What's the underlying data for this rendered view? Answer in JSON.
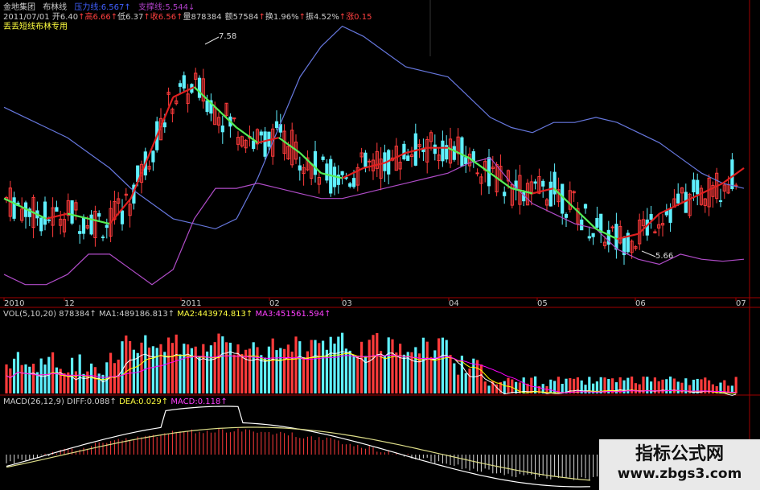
{
  "header": {
    "stock": "金地集团",
    "indicator": "布林线",
    "resist_label": "压力线:",
    "resist_value": "6.567",
    "support_label": "支撑线:",
    "support_value": "5.544",
    "line2": {
      "date": "2011/07/01",
      "open": "开6.40",
      "high": "高6.66",
      "low": "低6.37",
      "close": "收6.56",
      "volume": "量878384",
      "amount": "额57584",
      "turnover": "换1.96%",
      "amplitude": "振4.52%",
      "change": "涨0.15"
    },
    "subtitle": "丢丢短线布林专用"
  },
  "vol_header": {
    "label": "VOL(5,10,20)",
    "value": "878384",
    "ma1": "MA1:489186.813",
    "ma2": "MA2:443974.813",
    "ma3": "MA3:451561.594"
  },
  "macd_header": {
    "label": "MACD(26,12,9)",
    "diff": "DIFF:0.088",
    "dea": "DEA:0.029",
    "macd": "MACD:0.118"
  },
  "watermark": {
    "line1": "指标公式网",
    "line2": "www.zbgs3.com"
  },
  "colors": {
    "up": "#ff3b3b",
    "down": "#5ff0ff",
    "upper_band": "#6677dd",
    "lower_band": "#b04cc8",
    "mid_up": "#e02020",
    "mid_down": "#55ee55",
    "axis_red": "#a00000",
    "vol_ma1": "#ffffff",
    "vol_ma2": "#ffff00",
    "vol_ma3": "#ff00ff"
  },
  "chart_data": {
    "type": "candlestick",
    "x_ticks": [
      "2010",
      "12",
      "2011",
      "02",
      "03",
      "04",
      "05",
      "06",
      "07"
    ],
    "annotations": [
      {
        "text": "7.58",
        "kind": "high"
      },
      {
        "text": "5.66",
        "kind": "low"
      }
    ],
    "price_ylim": [
      5.2,
      7.9
    ],
    "upper_band": [
      7.0,
      6.9,
      6.8,
      6.7,
      6.55,
      6.4,
      6.2,
      6.05,
      5.9,
      5.85,
      5.8,
      5.9,
      6.3,
      6.8,
      7.3,
      7.6,
      7.8,
      7.7,
      7.55,
      7.4,
      7.35,
      7.3,
      7.1,
      6.9,
      6.8,
      6.75,
      6.85,
      6.85,
      6.9,
      6.85,
      6.75,
      6.65,
      6.5,
      6.35,
      6.25,
      6.2
    ],
    "lower_band": [
      5.35,
      5.25,
      5.25,
      5.35,
      5.55,
      5.55,
      5.4,
      5.25,
      5.4,
      5.9,
      6.2,
      6.2,
      6.25,
      6.2,
      6.15,
      6.1,
      6.1,
      6.15,
      6.2,
      6.25,
      6.3,
      6.35,
      6.45,
      6.5,
      6.25,
      6.05,
      5.95,
      5.85,
      5.8,
      5.6,
      5.5,
      5.45,
      5.55,
      5.5,
      5.48,
      5.5
    ],
    "mid_band": [
      6.1,
      6.0,
      5.9,
      5.95,
      5.9,
      5.85,
      6.1,
      6.6,
      7.1,
      7.2,
      7.0,
      6.8,
      6.65,
      6.7,
      6.55,
      6.35,
      6.3,
      6.4,
      6.45,
      6.55,
      6.6,
      6.6,
      6.5,
      6.35,
      6.2,
      6.15,
      6.2,
      6.0,
      5.8,
      5.7,
      5.75,
      5.95,
      6.05,
      6.15,
      6.25,
      6.4
    ]
  }
}
